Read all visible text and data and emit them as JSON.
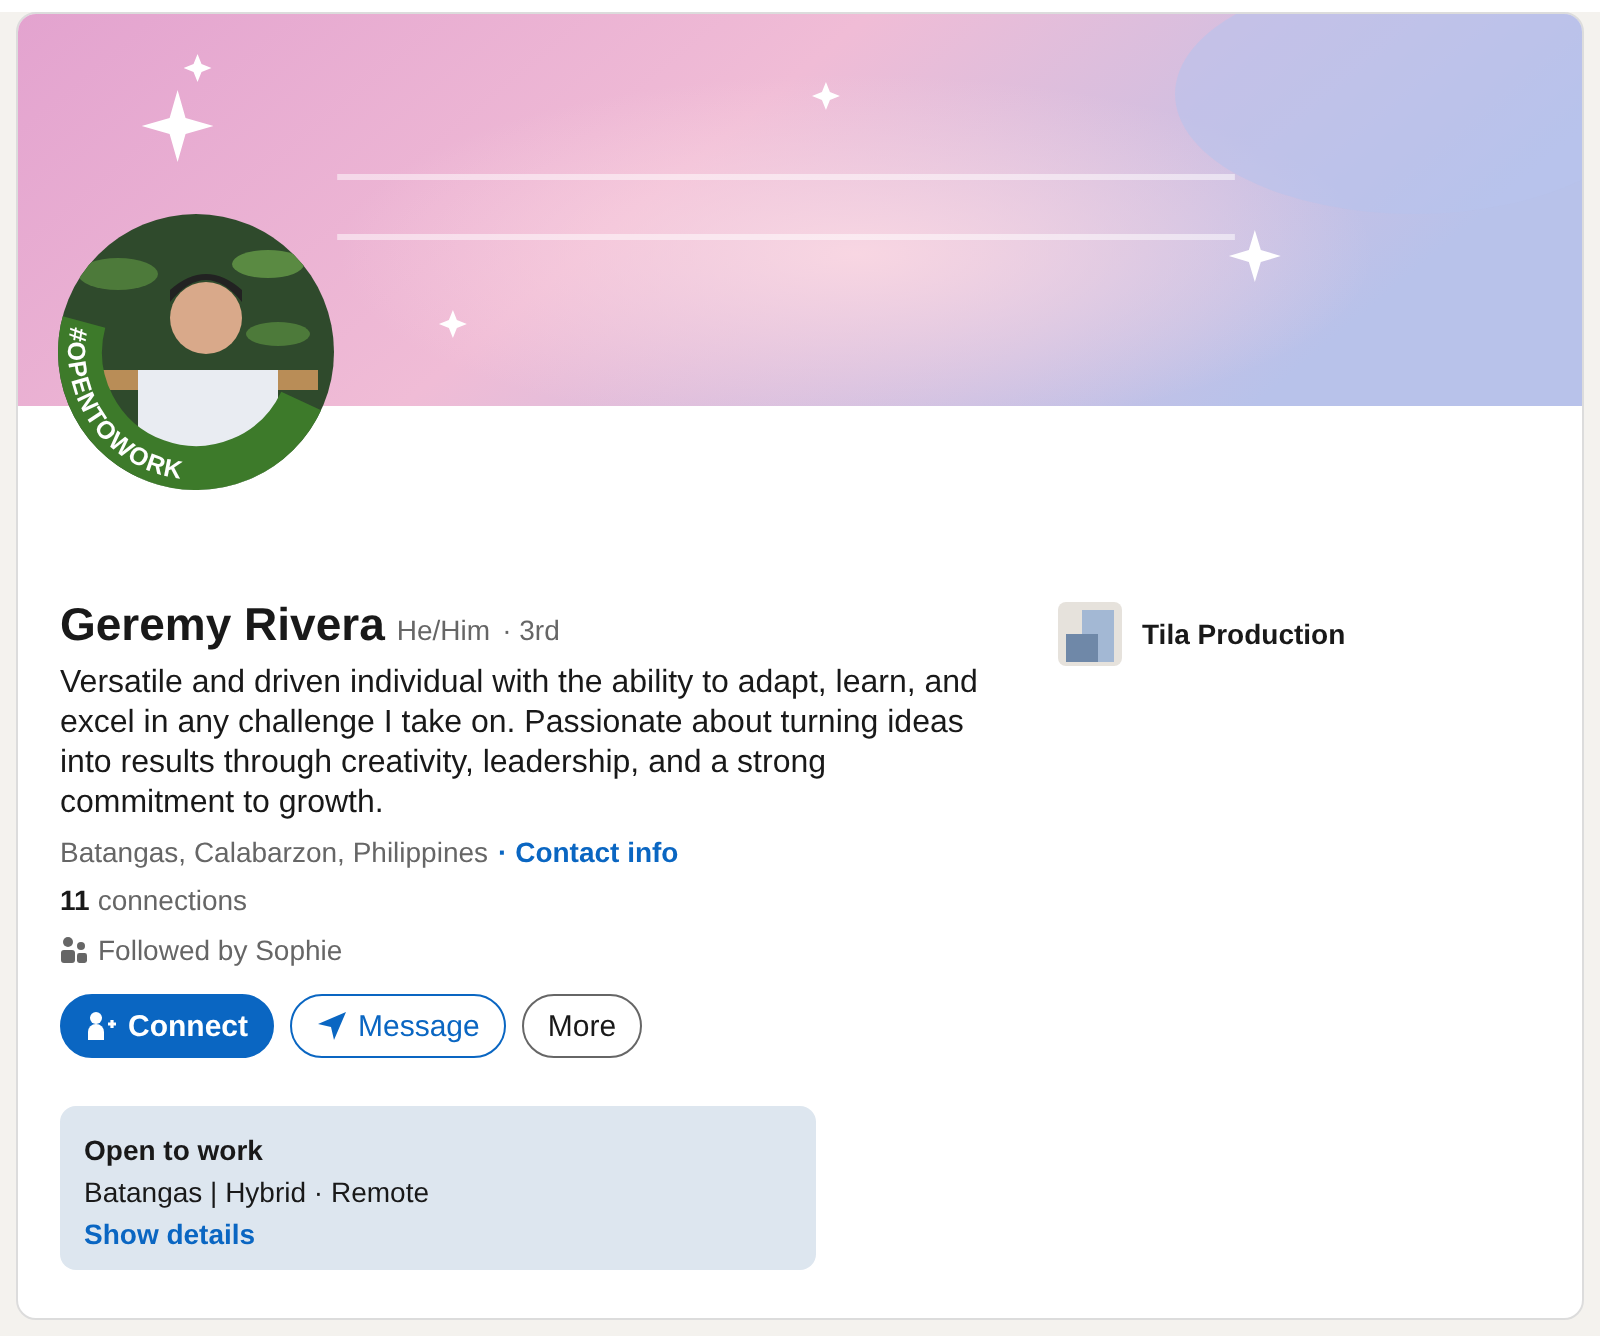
{
  "profile": {
    "frame_label": "#OPENTOWORK",
    "name": "Geremy Rivera",
    "pronouns": "He/Him",
    "degree": "· 3rd",
    "headline": "Versatile and driven individual with the ability to adapt, learn, and excel in any challenge I take on. Passionate about turning ideas into results through creativity, leadership, and a strong commitment to growth.",
    "location": "Batangas, Calabarzon, Philippines",
    "contact_link": "· Contact info",
    "connections_count": "11",
    "connections_label": "connections",
    "followed_by": "Followed by Sophie"
  },
  "actions": [
    {
      "label": "Connect",
      "kind": "primary"
    },
    {
      "label": "Message",
      "kind": "outline"
    },
    {
      "label": "More",
      "kind": "plain"
    }
  ],
  "company": {
    "name": "Tila Production"
  },
  "open_to_work": {
    "title": "Open to work",
    "details": "Batangas | Hybrid · Remote",
    "link": "Show details"
  }
}
